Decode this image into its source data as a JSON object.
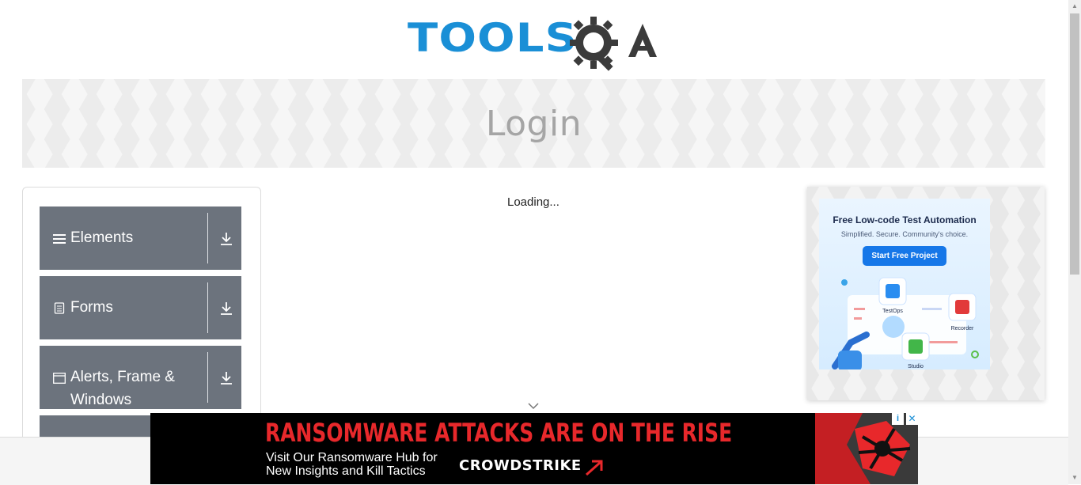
{
  "header": {
    "logo_text_left": "TOOLS",
    "logo_text_right": "QA"
  },
  "banner": {
    "title": "Login"
  },
  "sidebar": {
    "groups": [
      {
        "label": "Elements",
        "icon": "menu-icon"
      },
      {
        "label": "Forms",
        "icon": "document-icon"
      },
      {
        "label": "Alerts, Frame & Windows",
        "icon": "window-icon"
      }
    ]
  },
  "main": {
    "loading_text": "Loading..."
  },
  "right_ad": {
    "title": "Free Low-code Test Automation",
    "subtitle": "Simplified. Secure. Community's choice.",
    "button": "Start Free Project",
    "labels": [
      "TestOps",
      "Recorder",
      "Studio"
    ]
  },
  "bottom_ad": {
    "headline": "RANSOMWARE ATTACKS ARE ON THE RISE",
    "body_line1": "Visit Our Ransomware Hub for",
    "body_line2": "New Insights and Kill Tactics",
    "brand": "CROWDSTRIKE"
  },
  "colors": {
    "accent": "#1a8fd6",
    "sidebar_group": "#6c737d",
    "ad_red": "#e8282b"
  }
}
